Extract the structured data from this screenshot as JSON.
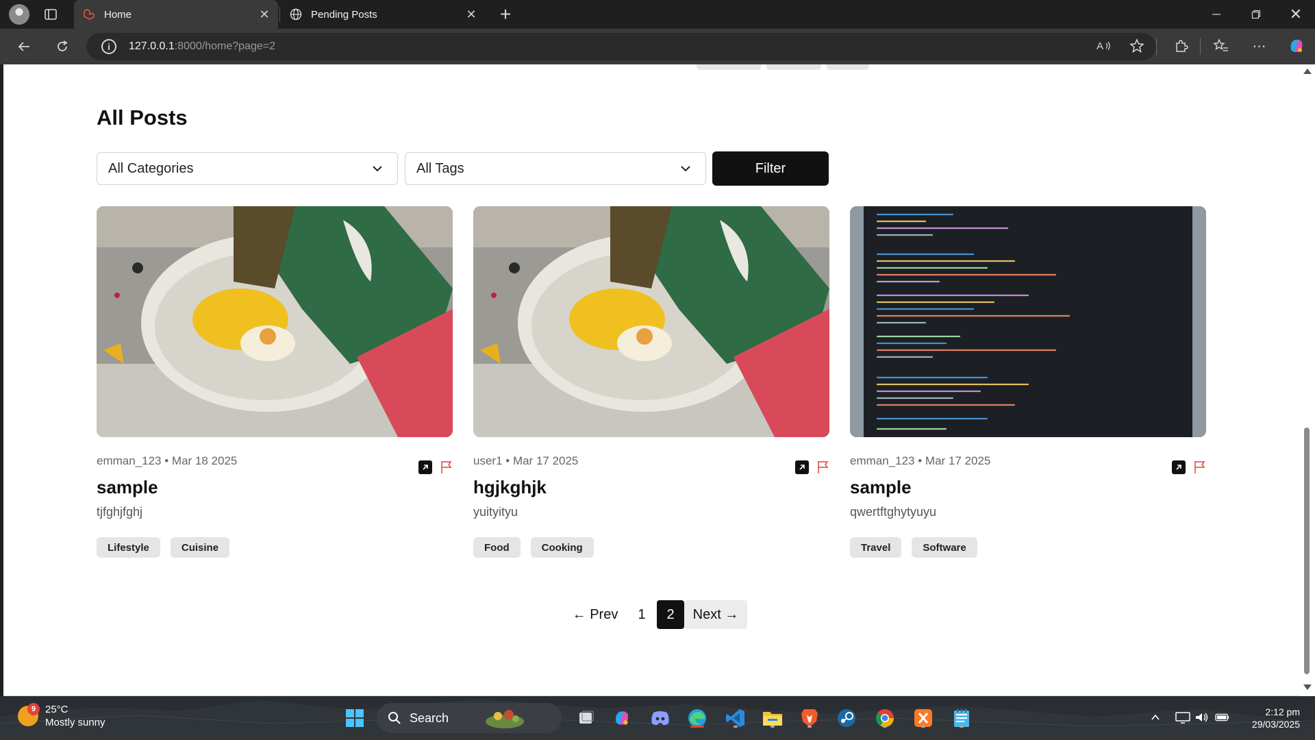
{
  "browser": {
    "tabs": [
      {
        "title": "Home",
        "active": true
      },
      {
        "title": "Pending Posts",
        "active": false
      }
    ],
    "url": {
      "host": "127.0.0.1",
      "rest": ":8000/home?page=2"
    },
    "close_glyph": "✕",
    "new_tab_glyph": "+",
    "more_glyph": "⋯"
  },
  "page": {
    "section_title": "All Posts",
    "filters": {
      "category": "All Categories",
      "tags": "All Tags",
      "button": "Filter"
    },
    "posts": [
      {
        "author": "emman_123",
        "date": "Mar 18 2025",
        "title": "sample",
        "excerpt": "tjfghjfghj",
        "tags": [
          "Lifestyle",
          "Cuisine"
        ],
        "image": "food-bowl-photo"
      },
      {
        "author": "user1",
        "date": "Mar 17 2025",
        "title": "hgjkghjk",
        "excerpt": "yuityityu",
        "tags": [
          "Food",
          "Cooking"
        ],
        "image": "food-bowl-photo"
      },
      {
        "author": "emman_123",
        "date": "Mar 17 2025",
        "title": "sample",
        "excerpt": "qwertftghytyuyu",
        "tags": [
          "Travel",
          "Software"
        ],
        "image": "code-screenshot"
      }
    ],
    "pagination": {
      "prev": "← Prev",
      "pages": [
        "1",
        "2"
      ],
      "current": "2",
      "next": "Next →"
    }
  },
  "taskbar": {
    "weather": {
      "temp": "25°C",
      "condition": "Mostly sunny",
      "badge": "9"
    },
    "search_label": "Search",
    "time": "2:12 pm",
    "date": "29/03/2025",
    "apps": [
      "windows-start",
      "search",
      "food-widget",
      "task-view",
      "copilot",
      "discord",
      "edge",
      "vscode",
      "file-explorer",
      "brave",
      "steam",
      "chrome",
      "xampp",
      "notepad"
    ]
  },
  "colors": {
    "accent_dark": "#111111",
    "tag_bg": "#e5e5e5",
    "flag_red": "#e0443a"
  }
}
